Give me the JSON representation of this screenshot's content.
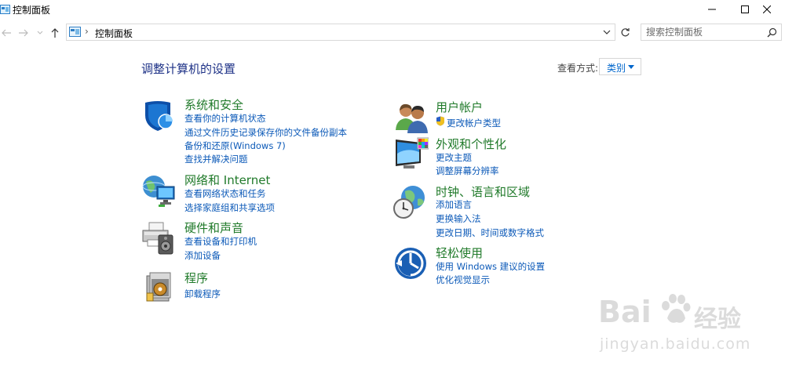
{
  "window": {
    "title": "控制面板"
  },
  "address_bar": {
    "path": "控制面板"
  },
  "search": {
    "placeholder": "搜索控制面板"
  },
  "main": {
    "title": "调整计算机的设置",
    "view_by_label": "查看方式:",
    "view_by_value": "类别"
  },
  "categories": {
    "system_security": {
      "title": "系统和安全",
      "links": [
        "查看你的计算机状态",
        "通过文件历史记录保存你的文件备份副本",
        "备份和还原(Windows 7)",
        "查找并解决问题"
      ]
    },
    "network": {
      "title": "网络和 Internet",
      "links": [
        "查看网络状态和任务",
        "选择家庭组和共享选项"
      ]
    },
    "hardware": {
      "title": "硬件和声音",
      "links": [
        "查看设备和打印机",
        "添加设备"
      ]
    },
    "programs": {
      "title": "程序",
      "links": [
        "卸载程序"
      ]
    },
    "user_accounts": {
      "title": "用户帐户",
      "links": [
        "更改帐户类型"
      ]
    },
    "appearance": {
      "title": "外观和个性化",
      "links": [
        "更改主题",
        "调整屏幕分辨率"
      ]
    },
    "clock_region": {
      "title": "时钟、语言和区域",
      "links": [
        "添加语言",
        "更换输入法",
        "更改日期、时间或数字格式"
      ]
    },
    "ease_of_access": {
      "title": "轻松使用",
      "links": [
        "使用 Windows 建议的设置",
        "优化视觉显示"
      ]
    }
  },
  "watermark": {
    "brand": "Bai",
    "brand2": "经验",
    "url": "jingyan.baidu.com"
  },
  "colors": {
    "category_title": "#207a2a",
    "link": "#0b59b8",
    "page_title": "#1e3287"
  }
}
